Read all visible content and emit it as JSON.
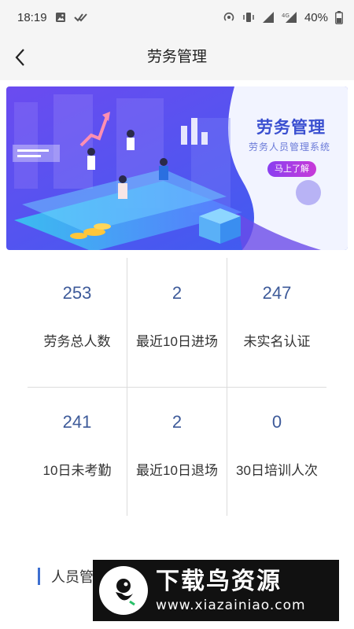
{
  "status_bar": {
    "time": "18:19",
    "network_label": "4G",
    "battery": "40%"
  },
  "nav": {
    "title": "劳务管理",
    "back_icon": "chevron-left-icon"
  },
  "banner": {
    "title": "劳务管理",
    "subtitle": "劳务人员管理系统",
    "cta": "马上了解",
    "colors": {
      "primary": "#4a3fe0",
      "accent": "#c83ad8",
      "light": "#eef1ff"
    }
  },
  "stats": [
    {
      "value": "253",
      "label": "劳务总人数"
    },
    {
      "value": "2",
      "label": "最近10日进场"
    },
    {
      "value": "247",
      "label": "未实名认证"
    },
    {
      "value": "241",
      "label": "10日未考勤"
    },
    {
      "value": "2",
      "label": "最近10日退场"
    },
    {
      "value": "0",
      "label": "30日培训人次"
    }
  ],
  "section": {
    "title": "人员管"
  },
  "watermark": {
    "title": "下载鸟资源",
    "url": "www.xiazainiao.com"
  },
  "colors": {
    "value_text": "#3d5a99",
    "section_bar": "#3d6fd0",
    "divider": "#dcdcdc"
  }
}
